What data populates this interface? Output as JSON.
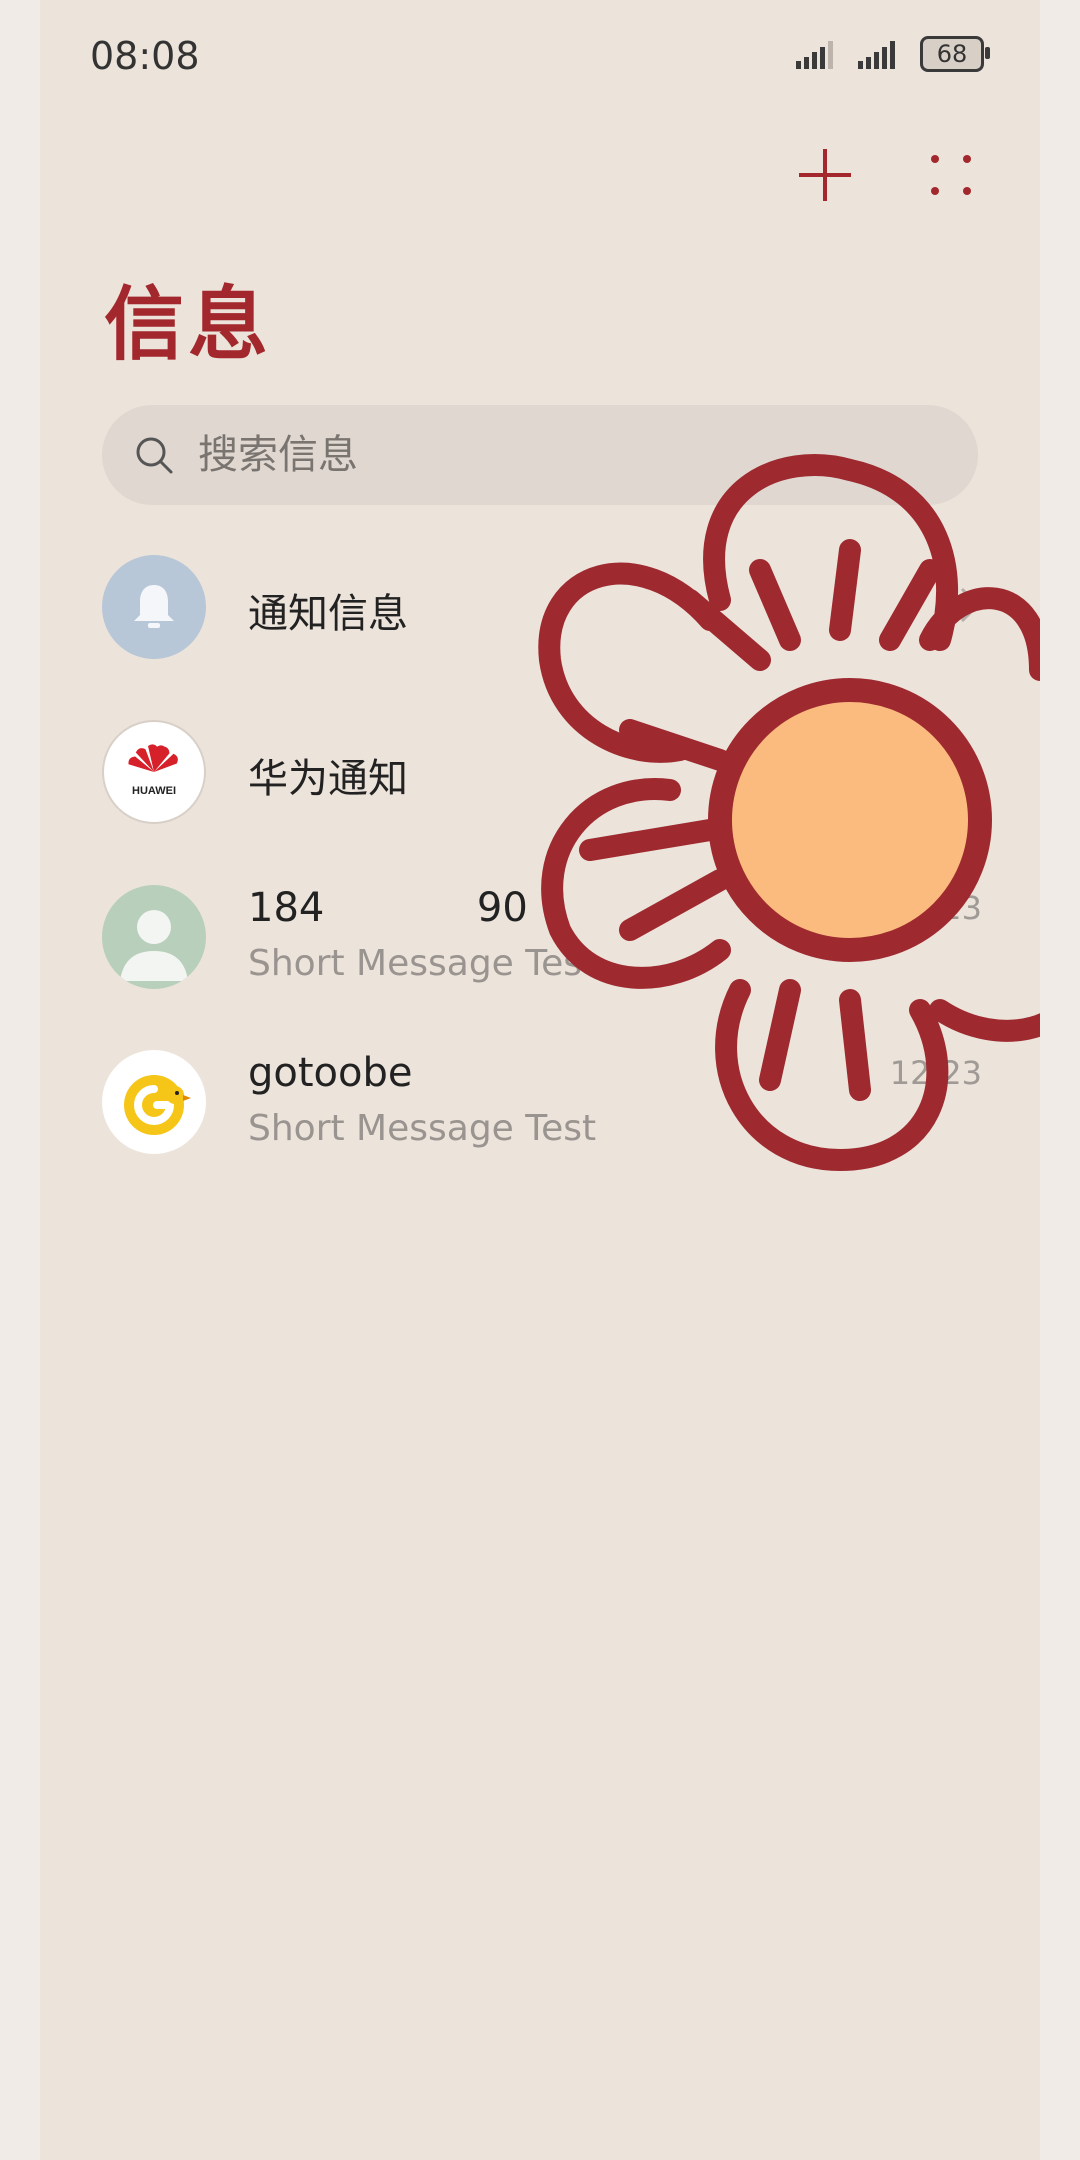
{
  "status": {
    "time": "08:08",
    "battery": "68"
  },
  "header": {
    "title": "信息"
  },
  "search": {
    "placeholder": "搜索信息"
  },
  "conversations": [
    {
      "name": "通知信息",
      "preview": "",
      "date": ""
    },
    {
      "name": "华为通知",
      "preview": "",
      "date": ""
    },
    {
      "name": "184            90",
      "preview": "Short Message Test",
      "date": "12/23"
    },
    {
      "name": "gotoobe",
      "preview": "Short Message Test",
      "date": "12/23"
    }
  ],
  "logos": {
    "huawei": "HUAWEI"
  },
  "colors": {
    "accent": "#a3282d",
    "background": "#ece3da",
    "search_bg": "#e0d8d0",
    "flower_center": "#fbbb7f"
  }
}
